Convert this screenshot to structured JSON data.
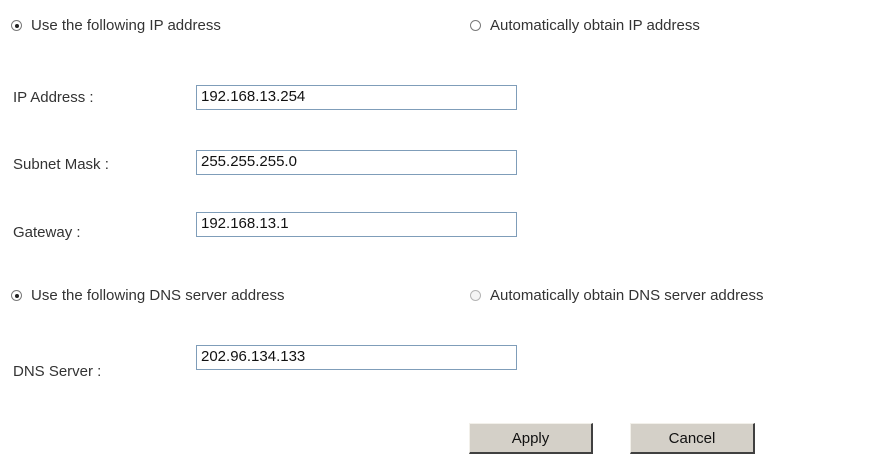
{
  "ip_mode": {
    "manual_label": "Use the following IP address",
    "manual_selected": true,
    "auto_label": "Automatically obtain IP address",
    "auto_selected": false
  },
  "fields": {
    "ip_address": {
      "label": "IP Address :",
      "value": "192.168.13.254"
    },
    "subnet_mask": {
      "label": "Subnet Mask :",
      "value": "255.255.255.0"
    },
    "gateway": {
      "label": "Gateway :",
      "value": "192.168.13.1"
    }
  },
  "dns_mode": {
    "manual_label": "Use the following DNS server address",
    "manual_selected": true,
    "auto_label": "Automatically obtain DNS server address",
    "auto_selected": false,
    "auto_disabled": true
  },
  "dns": {
    "label": "DNS Server :",
    "value": "202.96.134.133"
  },
  "buttons": {
    "apply_label": "Apply",
    "cancel_label": "Cancel"
  }
}
